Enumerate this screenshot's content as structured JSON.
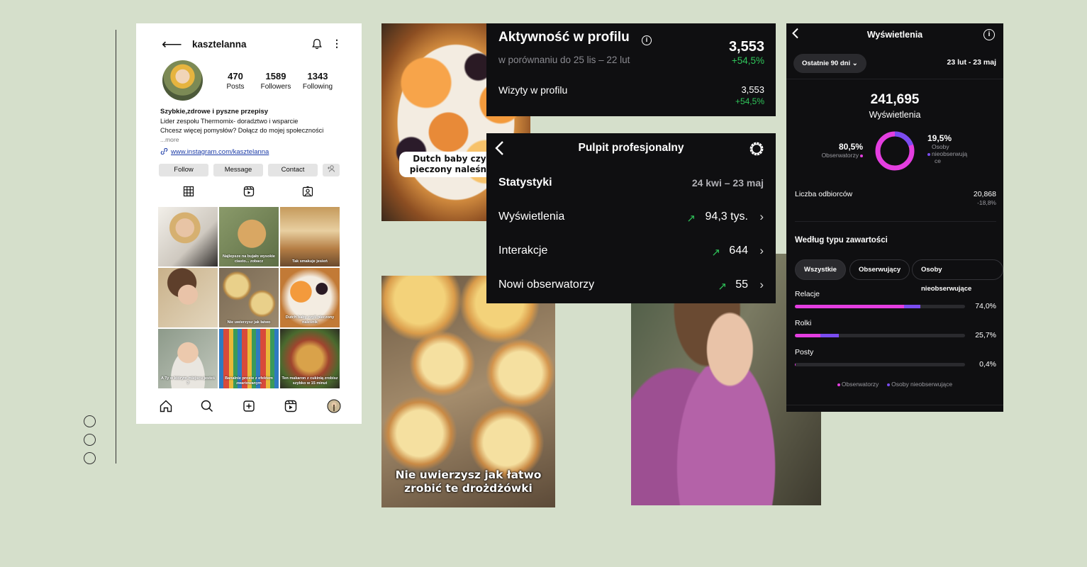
{
  "profile": {
    "username": "kasztelanna",
    "stats": [
      {
        "num": "470",
        "label": "Posts"
      },
      {
        "num": "1589",
        "label": "Followers"
      },
      {
        "num": "1343",
        "label": "Following"
      }
    ],
    "bio_name": "Szybkie,zdrowe i pyszne przepisy",
    "bio_line1": "Lider zespołu Thermomix- doradztwo i wsparcie",
    "bio_line2": "Chcesz więcej pomysłów? Dołącz do mojej społeczności",
    "bio_more": "...more",
    "link": "www.instagram.com/kasztelanna",
    "buttons": {
      "follow": "Follow",
      "message": "Message",
      "contact": "Contact"
    },
    "grid_captions": [
      "",
      "Najlepsze na bujało wysokie ciasto... zobacz",
      "Tak smakuje jesień",
      "",
      "Nie uwierzysz jak łatwo",
      "Dutch baby czyli pieczony naleśnik",
      "A Ty w którym miejscu jesteś ?",
      "Banalnie proste z efektem zwariowanym",
      "Ten makaron z cukinią zrobisz szybko w 15 minut"
    ]
  },
  "photos": {
    "dutch_caption": "Dutch baby czyli pieczony naleśnik",
    "buns_caption_l1": "Nie uwierzysz jak łatwo",
    "buns_caption_l2": "zrobić te drożdżówki"
  },
  "aktywnosc": {
    "title": "Aktywność w profilu",
    "compare": "w porównaniu do 25 lis – 22 lut",
    "total": "3,553",
    "total_change": "+54,5%",
    "row_label": "Wizyty w profilu",
    "row_value": "3,553",
    "row_change": "+54,5%"
  },
  "pulpit": {
    "title": "Pulpit profesjonalny",
    "stats_label": "Statystyki",
    "stats_range": "24 kwi – 23 maj",
    "rows": [
      {
        "label": "Wyświetlenia",
        "value": "94,3 tys."
      },
      {
        "label": "Interakcje",
        "value": "644"
      },
      {
        "label": "Nowi obserwatorzy",
        "value": "55"
      }
    ]
  },
  "wyswietlenia": {
    "title": "Wyświetlenia",
    "filter": "Ostatnie 90 dni",
    "range": "23 lut - 23 maj",
    "total": "241,695",
    "total_label": "Wyświetlenia",
    "followers_pct": "80,5%",
    "followers_label": "Obserwatorzy",
    "nonfollowers_pct": "19,5%",
    "nonfollowers_label_1": "Osoby",
    "nonfollowers_label_2": "nieobserwują",
    "nonfollowers_label_3": "ce",
    "donut_followers_fraction": 0.805,
    "audience_label": "Liczba odbiorców",
    "audience_value": "20,868",
    "audience_change": "-18,8%",
    "section_title": "Według typu zawartości",
    "chips": [
      "Wszystkie",
      "Obserwujący",
      "Osoby nieobserwujące"
    ],
    "content_rows": [
      {
        "label": "Relacje",
        "value": "74,0%",
        "followers_fraction": 0.64,
        "nonfollowers_fraction": 0.096
      },
      {
        "label": "Rolki",
        "value": "25,7%",
        "followers_fraction": 0.15,
        "nonfollowers_fraction": 0.107
      },
      {
        "label": "Posty",
        "value": "0,4%",
        "followers_fraction": 0.004,
        "nonfollowers_fraction": 0.0
      }
    ],
    "legend_followers": "Obserwatorzy",
    "legend_nonfollowers": "Osoby nieobserwujące",
    "colors": {
      "followers": "#e43ee0",
      "nonfollowers": "#7a4cf0",
      "positive": "#2fc55a"
    }
  }
}
